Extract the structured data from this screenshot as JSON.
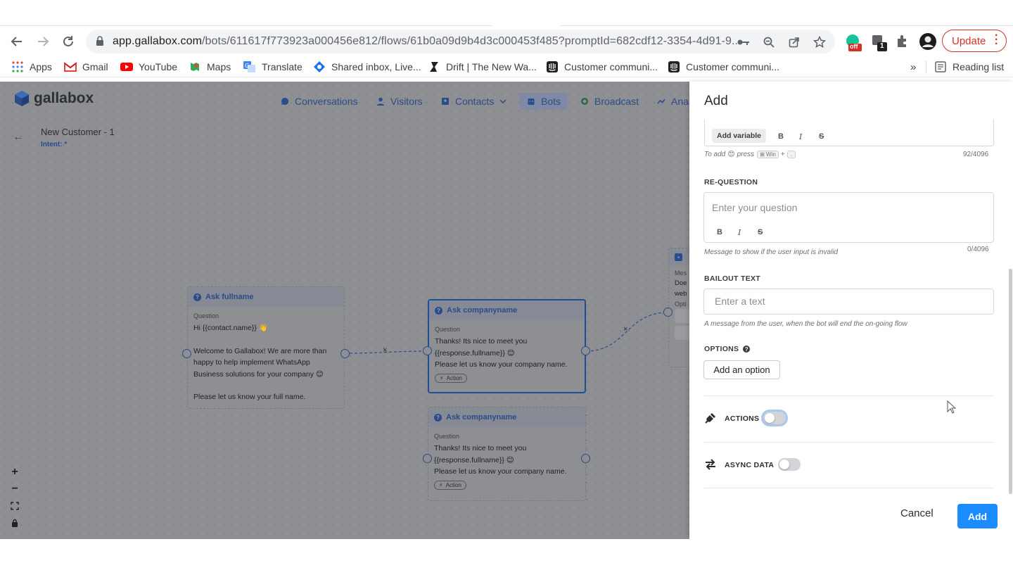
{
  "browser": {
    "url_host": "app.gallabox.com",
    "url_path": "/bots/611617f773923a000456e812/flows/61b0a09d9b4d3c000453f485?promptId=682cdf12-3354-4d91-9...",
    "ext_badge_off": "off",
    "ext_badge_count": "1",
    "update_label": "Update"
  },
  "bookmarks": [
    {
      "label": "Apps",
      "icon": "apps-grid-icon"
    },
    {
      "label": "Gmail",
      "icon": "gmail-icon"
    },
    {
      "label": "YouTube",
      "icon": "youtube-icon"
    },
    {
      "label": "Maps",
      "icon": "maps-icon"
    },
    {
      "label": "Translate",
      "icon": "translate-icon"
    },
    {
      "label": "Shared inbox, Live...",
      "icon": "shared-inbox-icon"
    },
    {
      "label": "Drift | The New Wa...",
      "icon": "drift-icon"
    },
    {
      "label": "Customer communi...",
      "icon": "intercom-icon"
    },
    {
      "label": "Customer communi...",
      "icon": "intercom-icon"
    }
  ],
  "bookmarks_more": "»",
  "reading_list": "Reading list",
  "app": {
    "logo": "gallabox",
    "nav": [
      "Conversations",
      "Visitors",
      "Contacts",
      "Bots",
      "Broadcast",
      "Anal"
    ],
    "flow_title": "New Customer - 1",
    "flow_intent": "Intent: *"
  },
  "nodes": {
    "fullname": {
      "title": "Ask fullname",
      "label": "Question",
      "line1": "Hi {{contact.name}} 👋",
      "line2": "Welcome to Gallabox! We are more than",
      "line3": "happy to help implement WhatsApp",
      "line4": "Business solutions for your company 😊",
      "line5": "Please let us know your full name."
    },
    "company1": {
      "title": "Ask companyname",
      "label": "Question",
      "line1": "Thanks! Its nice to meet you",
      "line2": "{{response.fullname}} 😊",
      "line3": "Please let us know your company name.",
      "action": "Action"
    },
    "company2": {
      "title": "Ask companyname",
      "label": "Question",
      "line1": "Thanks! Its nice to meet you",
      "line2": "{{response.fullname}} 😊",
      "line3": "Please let us know your company name.",
      "action": "Action"
    },
    "partial": {
      "label": "Mes",
      "line1": "Doe",
      "line2": "web",
      "opt": "Opti"
    }
  },
  "panel": {
    "title": "Add",
    "add_variable": "Add variable",
    "bold": "B",
    "italic": "I",
    "strike": "S",
    "emoji_hint_pre": "To add",
    "emoji_hint_press": "press",
    "emoji_hint_win": "⊞ Win",
    "emoji_hint_plus": "+",
    "emoji_hint_dot": ".",
    "counter1": "92/4096",
    "requestion_label": "RE-QUESTION",
    "requestion_placeholder": "Enter your question",
    "requestion_hint": "Message to show if the user input is invalid",
    "counter2": "0/4096",
    "bailout_label": "BAILOUT TEXT",
    "bailout_placeholder": "Enter a text",
    "bailout_hint": "A message from the user, when the bot will end the on-going flow",
    "options_label": "OPTIONS",
    "add_option": "Add an option",
    "actions_label": "ACTIONS",
    "async_label": "ASYNC DATA",
    "cancel": "Cancel",
    "add": "Add"
  },
  "colors": {
    "accent": "#1a8cff",
    "update_red": "#d93025",
    "canvas_overlay": "#8e8f92",
    "node_link": "#2a4c8a"
  }
}
